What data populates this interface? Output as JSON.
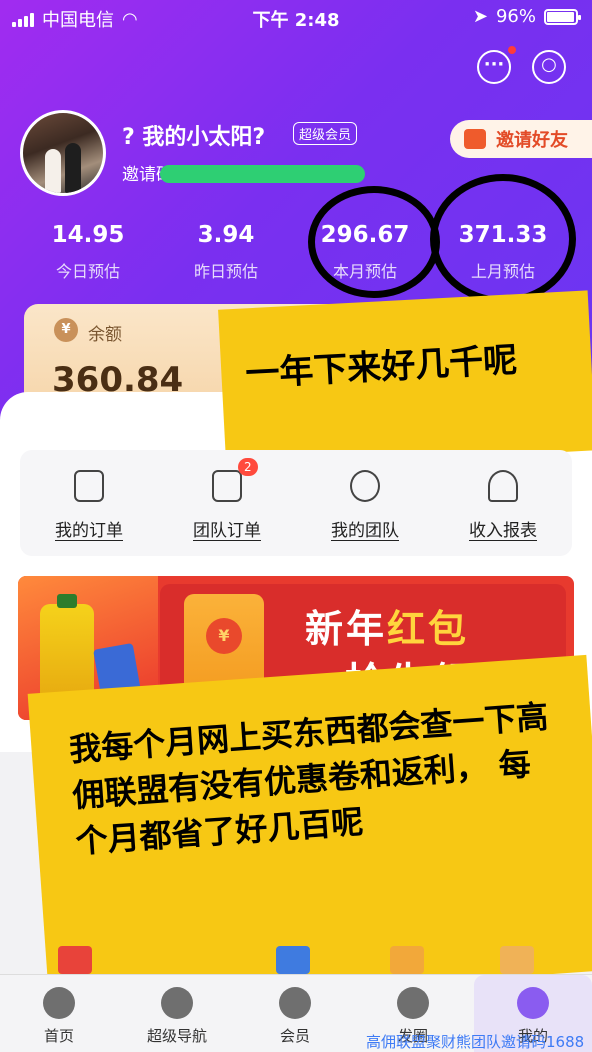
{
  "status_bar": {
    "carrier": "中国电信",
    "time": "下午 2:48",
    "battery": "96%",
    "battery_level": 0.96
  },
  "header": {
    "message_icon": "message-dots-icon",
    "settings_icon": "hexagon-settings-icon"
  },
  "profile": {
    "name": "? 我的小太阳?",
    "badge": "超级会员",
    "invite_code_label": "邀请码",
    "invite_button": "邀请好友"
  },
  "stats": [
    {
      "value": "14.95",
      "label": "今日预估"
    },
    {
      "value": "3.94",
      "label": "昨日预估"
    },
    {
      "value": "296.67",
      "label": "本月预估"
    },
    {
      "value": "371.33",
      "label": "上月预估"
    }
  ],
  "balance": {
    "label": "余额",
    "value": "360.84"
  },
  "quick_menu": [
    {
      "label": "我的订单",
      "icon": "order-icon"
    },
    {
      "label": "团队订单",
      "icon": "team-order-icon",
      "badge": "2"
    },
    {
      "label": "我的团队",
      "icon": "team-icon"
    },
    {
      "label": "收入报表",
      "icon": "report-icon"
    }
  ],
  "banner": {
    "title_prefix": "新年",
    "title_highlight": "红包",
    "subtitle": "抢先领"
  },
  "annotations": {
    "note1": "一年下来好几千呢",
    "note2": "我每个月网上买东西都会查一下高佣联盟有没有优惠卷和返利， 每个月都省了好几百呢"
  },
  "tab_bar": [
    {
      "label": "首页",
      "icon": "home-icon"
    },
    {
      "label": "超级导航",
      "icon": "navigation-icon"
    },
    {
      "label": "会员",
      "icon": "vip-icon"
    },
    {
      "label": "发圈",
      "icon": "share-circle-icon"
    },
    {
      "label": "我的",
      "icon": "profile-icon",
      "active": true
    }
  ],
  "watermark": "高佣联盟聚财熊团队邀请码1688",
  "colors": {
    "header_purple": "#7a2ff0",
    "accent_red": "#e34b27",
    "note_yellow": "#f7c814"
  }
}
